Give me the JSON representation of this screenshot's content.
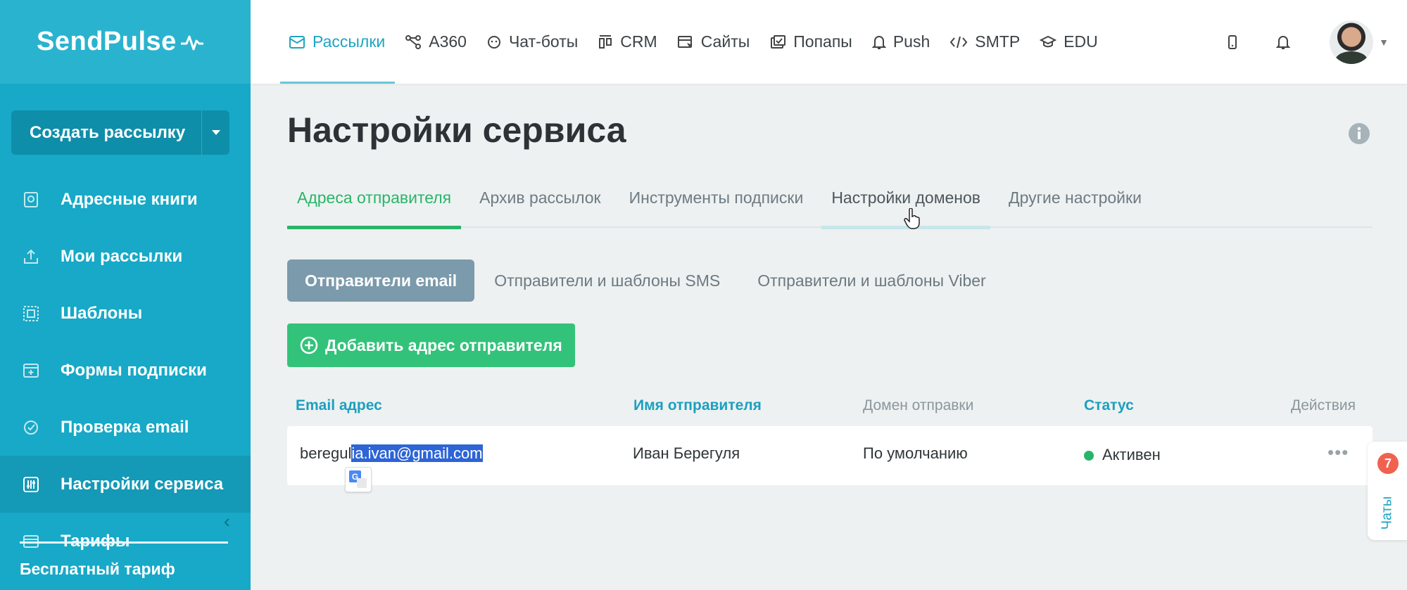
{
  "brand": {
    "name": "SendPulse"
  },
  "sidebar": {
    "create_button": "Создать рассылку",
    "items": [
      {
        "label": "Адресные книги",
        "icon": "address-book-icon"
      },
      {
        "label": "Мои рассылки",
        "icon": "upload-icon"
      },
      {
        "label": "Шаблоны",
        "icon": "template-icon"
      },
      {
        "label": "Формы подписки",
        "icon": "form-icon"
      },
      {
        "label": "Проверка email",
        "icon": "check-icon"
      },
      {
        "label": "Настройки сервиса",
        "icon": "sliders-icon"
      },
      {
        "label": "Тарифы",
        "icon": "card-icon"
      }
    ],
    "plan": "Бесплатный тариф"
  },
  "topnav": {
    "items": [
      {
        "label": "Рассылки",
        "icon": "mail-icon"
      },
      {
        "label": "А360",
        "icon": "automation-icon"
      },
      {
        "label": "Чат-боты",
        "icon": "chatbot-icon"
      },
      {
        "label": "CRM",
        "icon": "crm-icon"
      },
      {
        "label": "Сайты",
        "icon": "sites-icon"
      },
      {
        "label": "Попапы",
        "icon": "popup-icon"
      },
      {
        "label": "Push",
        "icon": "bell-icon"
      },
      {
        "label": "SMTP",
        "icon": "code-icon"
      },
      {
        "label": "EDU",
        "icon": "graduation-cap-icon"
      }
    ]
  },
  "page": {
    "title": "Настройки сервиса",
    "tabs": [
      "Адреса отправителя",
      "Архив рассылок",
      "Инструменты подписки",
      "Настройки доменов",
      "Другие настройки"
    ],
    "subtabs": [
      "Отправители email",
      "Отправители и шаблоны SMS",
      "Отправители и шаблоны Viber"
    ],
    "add_button": "Добавить адрес отправителя"
  },
  "table": {
    "headers": [
      "Email адрес",
      "Имя отправителя",
      "Домен отправки",
      "Статус",
      "Действия"
    ],
    "rows": [
      {
        "email_prefix": "beregul",
        "email_selected": "ia.ivan@gmail.com",
        "name": "Иван Берегуля",
        "domain": "По умолчанию",
        "status": "Активен"
      }
    ]
  },
  "chats": {
    "label": "Чаты",
    "count": "7"
  },
  "colors": {
    "sidebar": "#17a9c7",
    "accent": "#1fa4c2",
    "green": "#28b56a",
    "button_green": "#33c27a"
  }
}
